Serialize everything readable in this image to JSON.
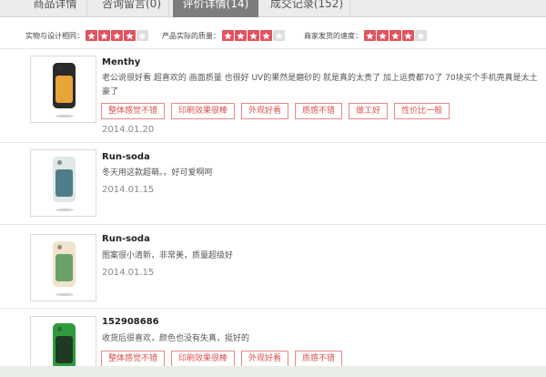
{
  "tabs": [
    {
      "label": "商品详情"
    },
    {
      "label": "咨询留言(0)"
    },
    {
      "label": "评价详情(14)"
    },
    {
      "label": "成交记录(152)"
    }
  ],
  "ratings": [
    {
      "label": "实物与设计相同：",
      "score": 4,
      "max": 5
    },
    {
      "label": "产品实际的质量：",
      "score": 4,
      "max": 5
    },
    {
      "label": "商家发货的速度：",
      "score": 4,
      "max": 5
    }
  ],
  "reviews": [
    {
      "user": "Menthy",
      "text": "老公说很好看 超喜欢的 画面质量 也很好 UV的果然是磨砂的 就是真的太贵了 加上运费都70了 70块买个手机壳真是太土豪了",
      "tags": [
        "整体感觉不错",
        "印刷效果很棒",
        "外观好看",
        "质感不错",
        "做工好",
        "性价比一般"
      ],
      "date": "2014.01.20",
      "case_colors": [
        "#2a2a2a",
        "#e7a43a"
      ]
    },
    {
      "user": "Run-soda",
      "text": "冬天用这款超萌。。好可爱啊呵",
      "tags": [],
      "date": "2014.01.15",
      "case_colors": [
        "#dfe8e6",
        "#4f7c8a"
      ]
    },
    {
      "user": "Run-soda",
      "text": "图案很小清新，非常美，质量超级好",
      "tags": [],
      "date": "2014.01.15",
      "case_colors": [
        "#f2e3cf",
        "#6aa36a"
      ]
    },
    {
      "user": "152908686",
      "text": "收货后很喜欢，颜色也没有失真，挺好的",
      "tags": [
        "整体感觉不错",
        "印刷效果很棒",
        "外观好看",
        "质感不错"
      ],
      "date": "",
      "case_colors": [
        "#2f9a3e",
        "#1f3a22"
      ]
    }
  ],
  "colors": {
    "accent": "#e0555e",
    "active_tab": "#7d7d7d",
    "tag_border": "#e58a8a"
  }
}
